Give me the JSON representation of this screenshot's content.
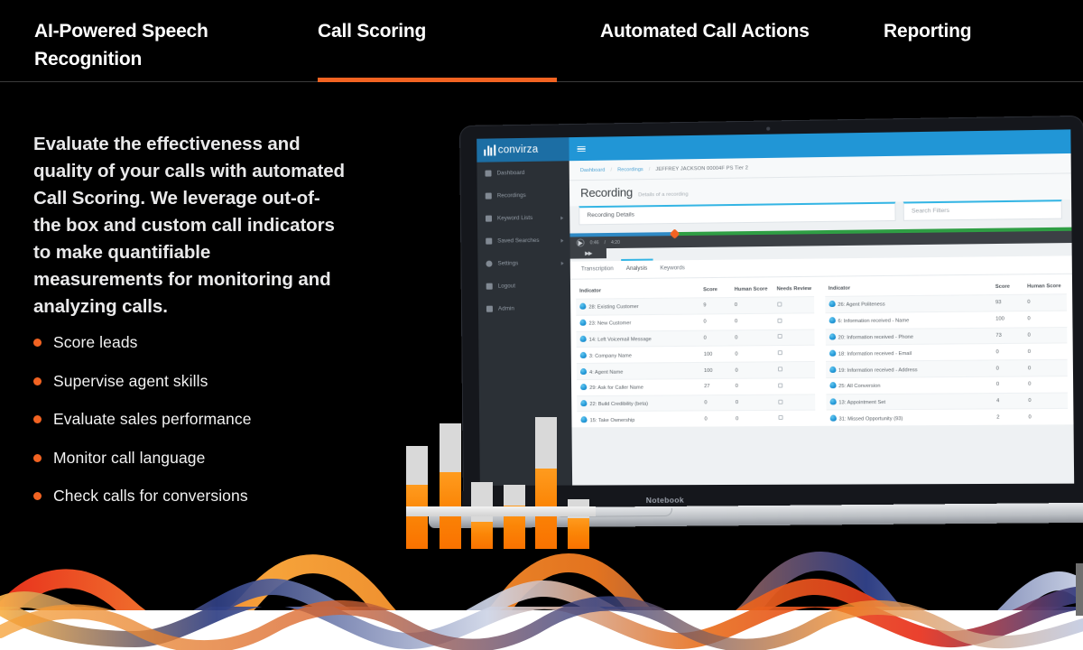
{
  "topnav": {
    "items": [
      {
        "label": "AI-Powered Speech Recognition",
        "active": false
      },
      {
        "label": "Call Scoring",
        "active": true
      },
      {
        "label": "Automated Call Actions",
        "active": false
      },
      {
        "label": "Reporting",
        "active": false
      }
    ],
    "accent_color": "#f26322"
  },
  "left": {
    "lead_paragraph": "Evaluate the effectiveness and quality of your calls with automated Call Scoring. We leverage out-of-the box and custom call indicators to make quantifiable measurements for monitoring and analyzing calls.",
    "bullets": [
      "Score leads",
      "Supervise agent skills",
      "Evaluate sales performance",
      "Monitor call language",
      "Check calls for conversions"
    ],
    "bullet_color": "#f26322"
  },
  "chart_data": {
    "type": "bar",
    "title": "",
    "categories": [
      "1",
      "2",
      "3",
      "4",
      "5",
      "6"
    ],
    "series": [
      {
        "name": "Filled",
        "values": [
          62,
          75,
          26,
          42,
          78,
          30
        ]
      },
      {
        "name": "Track",
        "values": [
          100,
          122,
          65,
          62,
          128,
          48
        ]
      }
    ],
    "ylim": [
      0,
      130
    ],
    "grid": false,
    "legend": "none",
    "fill_color": "#f97200",
    "track_color": "#d9d9d9"
  },
  "laptop": {
    "model_label": "Notebook"
  },
  "app": {
    "brand": "convirza",
    "sidebar": [
      {
        "label": "Dashboard",
        "icon": "home-icon",
        "caret": false
      },
      {
        "label": "Recordings",
        "icon": "file-icon",
        "caret": false
      },
      {
        "label": "Keyword Lists",
        "icon": "list-icon",
        "caret": true
      },
      {
        "label": "Saved Searches",
        "icon": "bookmark-icon",
        "caret": true
      },
      {
        "label": "Settings",
        "icon": "gear-icon",
        "caret": true
      },
      {
        "label": "Logout",
        "icon": "power-icon",
        "caret": false
      },
      {
        "label": "Admin",
        "icon": "tools-icon",
        "caret": false
      }
    ],
    "breadcrumb": {
      "items": [
        "Dashboard",
        "Recordings"
      ],
      "separator": "/",
      "current": "JEFFREY JACKSON 00004F PS Tier 2"
    },
    "page_title": "Recording",
    "page_subtitle": "Details of a recording",
    "panels": {
      "details_label": "Recording Details",
      "search_placeholder": "Search Filters"
    },
    "player": {
      "elapsed": "0:46",
      "separator": "/",
      "duration": "4:20"
    },
    "tabs": [
      {
        "label": "Transcription",
        "active": false
      },
      {
        "label": "Analysis",
        "active": true
      },
      {
        "label": "Keywords",
        "active": false
      }
    ],
    "table": {
      "headers": [
        "Indicator",
        "Score",
        "Human Score",
        "Needs Review"
      ],
      "left_rows": [
        {
          "indicator": "28: Existing Customer",
          "score": "9",
          "human_score": "0"
        },
        {
          "indicator": "23: New Customer",
          "score": "0",
          "human_score": "0"
        },
        {
          "indicator": "14: Left Voicemail Message",
          "score": "0",
          "human_score": "0"
        },
        {
          "indicator": "3: Company Name",
          "score": "100",
          "human_score": "0"
        },
        {
          "indicator": "4: Agent Name",
          "score": "100",
          "human_score": "0"
        },
        {
          "indicator": "29: Ask for Caller Name",
          "score": "27",
          "human_score": "0"
        },
        {
          "indicator": "22: Build Credibility (beta)",
          "score": "0",
          "human_score": "0"
        },
        {
          "indicator": "15: Take Ownership",
          "score": "0",
          "human_score": "0"
        }
      ],
      "right_rows": [
        {
          "indicator": "26: Agent Politeness",
          "score": "93",
          "human_score": "0"
        },
        {
          "indicator": "6: Information received - Name",
          "score": "100",
          "human_score": "0"
        },
        {
          "indicator": "20: Information received - Phone",
          "score": "73",
          "human_score": "0"
        },
        {
          "indicator": "18: Information received - Email",
          "score": "0",
          "human_score": "0"
        },
        {
          "indicator": "19: Information received - Address",
          "score": "0",
          "human_score": "0"
        },
        {
          "indicator": "25: All Conversion",
          "score": "0",
          "human_score": "0"
        },
        {
          "indicator": "13: Appointment Set",
          "score": "4",
          "human_score": "0"
        },
        {
          "indicator": "31: Missed Opportunity (93)",
          "score": "2",
          "human_score": "0"
        }
      ]
    }
  }
}
